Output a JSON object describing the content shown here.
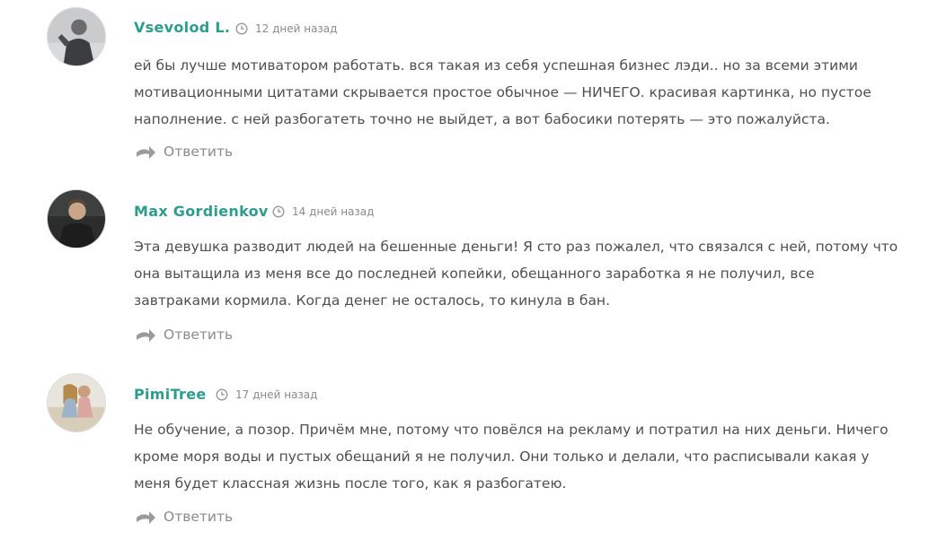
{
  "comments": [
    {
      "author": "Vsevolod L.",
      "time": "12 дней назад",
      "text": "ей бы лучше мотиватором работать. вся такая из себя успешная бизнес лэди.. но за всеми этими\nмотивационными цитатами скрывается простое обычное — НИЧЕГО. красивая картинка, но пустое\nнаполнение. с ней разбогатеть точно не выйдет, а вот бабосики потерять — это пожалуйста.",
      "reply_label": "Ответить"
    },
    {
      "author": "Max Gordienkov",
      "time": "14 дней назад",
      "text": "Эта девушка разводит людей на бешенные деньги! Я сто раз пожалел, что связался с ней, потому что\nона вытащила из меня все до последней копейки, обещанного заработка я не получил, все\nзавтраками кормила. Когда денег не осталось, то кинула в бан.",
      "reply_label": "Ответить"
    },
    {
      "author": "PimiTree",
      "time": "17 дней назад",
      "text": "Не обучение, а позор. Причём мне, потому что повёлся на рекламу и потратил на них деньги. Ничего\nкроме моря воды и пустых обещаний я не получил. Они только и делали, что расписывали какая у\nменя будет классная жизнь после того, как я разбогатею.",
      "reply_label": "Ответить"
    }
  ],
  "colors": {
    "author": "#2a9d8f",
    "text": "#4f4f4f",
    "meta": "#8a8a8a"
  },
  "icons": {
    "time": "clock-icon",
    "reply": "reply-arrow-icon"
  }
}
